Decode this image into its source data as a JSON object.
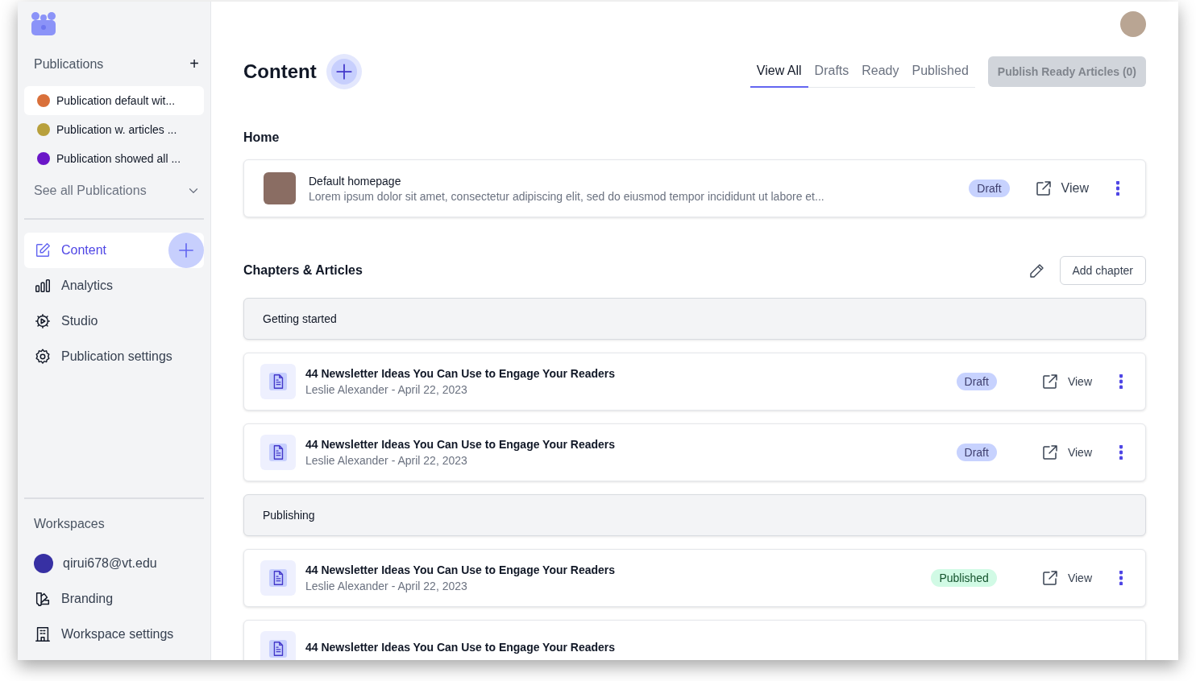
{
  "sidebar": {
    "publications_title": "Publications",
    "add_label": "+",
    "publications": [
      {
        "name": "Publication default wit...",
        "color": "#d9703a",
        "selected": true
      },
      {
        "name": "Publication w. articles ...",
        "color": "#b8a03c",
        "selected": false
      },
      {
        "name": "Publication showed all ...",
        "color": "#6a16c8",
        "selected": false
      }
    ],
    "see_all": "See all Publications",
    "nav": [
      {
        "label": "Content",
        "selected": true
      },
      {
        "label": "Analytics",
        "selected": false
      },
      {
        "label": "Studio",
        "selected": false
      },
      {
        "label": "Publication settings",
        "selected": false
      }
    ],
    "workspaces_title": "Workspaces",
    "workspace_items": [
      {
        "label": "qirui678@vt.edu"
      },
      {
        "label": "Branding"
      },
      {
        "label": "Workspace settings"
      }
    ]
  },
  "header": {
    "title": "Content",
    "tabs": [
      {
        "label": "View All",
        "selected": true
      },
      {
        "label": "Drafts",
        "selected": false
      },
      {
        "label": "Ready",
        "selected": false
      },
      {
        "label": "Published",
        "selected": false
      }
    ],
    "publish_button": {
      "label": "Publish Ready Articles (0)",
      "disabled": true
    }
  },
  "home": {
    "title": "Home",
    "page": {
      "title": "Default homepage",
      "description": "Lorem ipsum dolor sit amet, consectetur adipiscing elit, sed do eiusmod tempor incididunt ut labore et...",
      "status": {
        "label": "Draft",
        "kind": "draft"
      },
      "view": "View"
    }
  },
  "chapters": {
    "title": "Chapters & Articles",
    "add_button": "Add chapter",
    "items": [
      {
        "kind": "chapter",
        "title": "Getting started"
      },
      {
        "kind": "article",
        "title": "44 Newsletter Ideas You Can Use to Engage Your Readers",
        "meta": "Leslie Alexander - April 22, 2023",
        "status": {
          "label": "Draft",
          "kind": "draft"
        },
        "view": "View"
      },
      {
        "kind": "article",
        "title": "44 Newsletter Ideas You Can Use to Engage Your Readers",
        "meta": "Leslie Alexander - April 22, 2023",
        "status": {
          "label": "Draft",
          "kind": "draft"
        },
        "view": "View"
      },
      {
        "kind": "chapter",
        "title": "Publishing"
      },
      {
        "kind": "article",
        "title": "44 Newsletter Ideas You Can Use to Engage Your Readers",
        "meta": "Leslie Alexander - April 22, 2023",
        "status": {
          "label": "Published",
          "kind": "published"
        },
        "view": "View"
      },
      {
        "kind": "article",
        "title": "44 Newsletter Ideas You Can Use to Engage Your Readers"
      }
    ]
  }
}
